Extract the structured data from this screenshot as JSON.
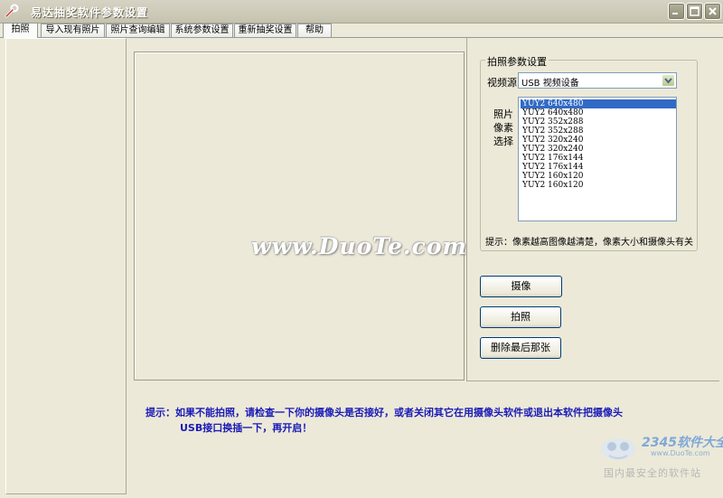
{
  "window": {
    "title": "易达抽奖软件参数设置",
    "icon": "wrench-icon"
  },
  "tabs": [
    {
      "label": "拍照",
      "active": true
    },
    {
      "label": "导入现有照片",
      "active": false
    },
    {
      "label": "照片查询编辑",
      "active": false
    },
    {
      "label": "系统参数设置",
      "active": false
    },
    {
      "label": "重新抽奖设置",
      "active": false
    },
    {
      "label": "帮助",
      "active": false
    }
  ],
  "photo_settings": {
    "group_title": "拍照参数设置",
    "video_source_label": "视频源",
    "video_source_value": "USB 视频设备",
    "pixel_label_1": "照片",
    "pixel_label_2": "像素",
    "pixel_label_3": "选择",
    "resolutions": [
      "YUY2 640x480",
      "YUY2 640x480",
      "YUY2 352x288",
      "YUY2 352x288",
      "YUY2 320x240",
      "YUY2 320x240",
      "YUY2 176x144",
      "YUY2 176x144",
      "YUY2 160x120",
      "YUY2 160x120"
    ],
    "selected_index": 0,
    "hint": "提示：像素越高图像越清楚，像素大小和摄像头有关"
  },
  "buttons": {
    "camera": "摄像",
    "capture": "拍照",
    "delete_last": "删除最后那张"
  },
  "bottom_hint": {
    "line1": "提示：如果不能拍照，请检查一下你的摄像头是否接好，或者关闭其它在用摄像头软件或退出本软件把摄像头",
    "line2": "USB接口换插一下，再开启！"
  },
  "watermark": "www.DuoTe.com",
  "logo": {
    "brand": "2345软件大全",
    "url": "www.DuoTe.com",
    "slogan": "国内最安全的软件站"
  },
  "colors": {
    "window_bg": "#ece9d8",
    "selection": "#316ac5",
    "hint_text": "#1a1ab8"
  }
}
